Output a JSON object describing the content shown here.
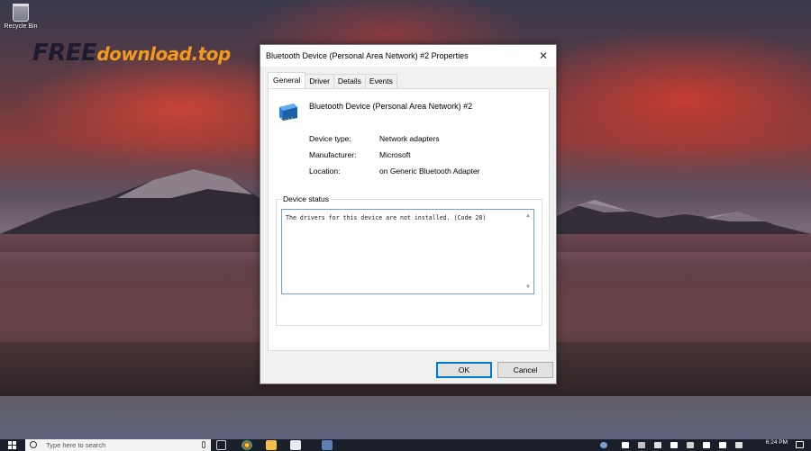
{
  "desktop": {
    "recycle_bin_label": "Recycle Bin",
    "watermark_part1": "FREE",
    "watermark_part2": "download.top"
  },
  "dialog": {
    "title": "Bluetooth Device (Personal Area Network) #2 Properties",
    "close_glyph": "✕",
    "tabs": [
      {
        "label": "General",
        "active": true
      },
      {
        "label": "Driver",
        "active": false
      },
      {
        "label": "Details",
        "active": false
      },
      {
        "label": "Events",
        "active": false
      }
    ],
    "device_name": "Bluetooth Device (Personal Area Network) #2",
    "device_icon": "network-adapter-icon",
    "properties": {
      "device_type_label": "Device type:",
      "device_type_value": "Network adapters",
      "manufacturer_label": "Manufacturer:",
      "manufacturer_value": "Microsoft",
      "location_label": "Location:",
      "location_value": "on Generic Bluetooth Adapter"
    },
    "device_status_label": "Device status",
    "device_status_text": "The drivers for this device are not installed. (Code 28)",
    "ok_label": "OK",
    "cancel_label": "Cancel"
  },
  "taskbar": {
    "search_placeholder": "Type here to search",
    "clock_time": "6:24 PM",
    "clock_date": "",
    "accent_color": "#0078d7"
  }
}
